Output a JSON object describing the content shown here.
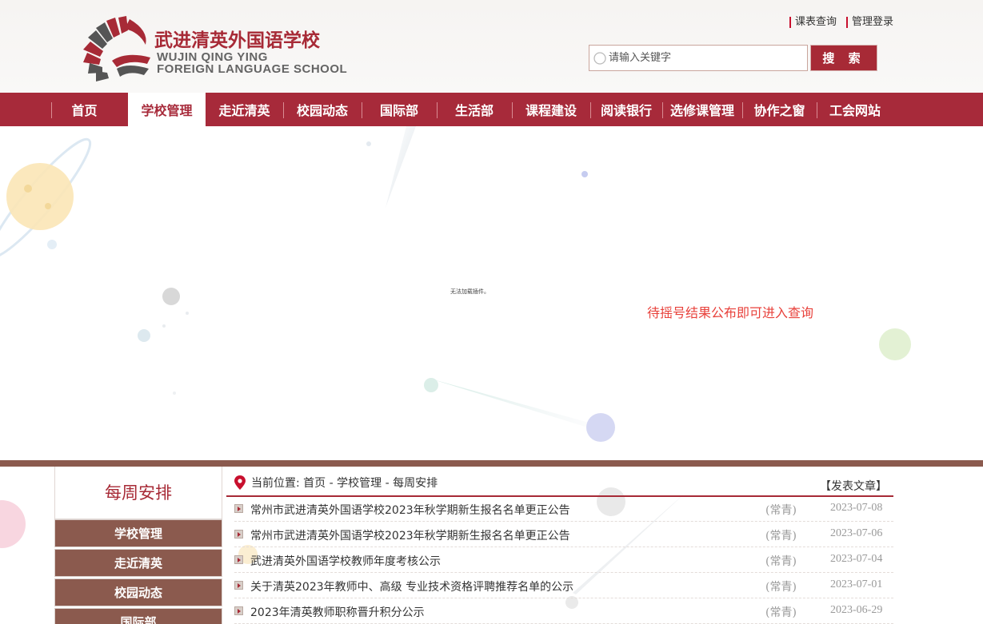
{
  "header": {
    "school_name_cn": "武进清英外国语学校",
    "school_name_en_line1": "WUJIN QING YING",
    "school_name_en_line2": "FOREIGN LANGUAGE SCHOOL",
    "top_links": [
      {
        "label": "课表查询"
      },
      {
        "label": "管理登录"
      }
    ],
    "search": {
      "placeholder": "请输入关键字",
      "button_label": "搜 索"
    }
  },
  "nav": {
    "items": [
      {
        "label": "首页"
      },
      {
        "label": "学校管理",
        "active": true
      },
      {
        "label": "走近清英"
      },
      {
        "label": "校园动态"
      },
      {
        "label": "国际部"
      },
      {
        "label": "生活部"
      },
      {
        "label": "课程建设"
      },
      {
        "label": "阅读银行"
      },
      {
        "label": "选修课管理"
      },
      {
        "label": "协作之窗"
      },
      {
        "label": "工会网站"
      }
    ]
  },
  "banner": {
    "plugin_message": "无法加载插件。",
    "lottery_message": "待摇号结果公布即可进入查询"
  },
  "sidebar": {
    "title": "每周安排",
    "menu": [
      {
        "label": "学校管理"
      },
      {
        "label": "走近清英"
      },
      {
        "label": "校园动态"
      },
      {
        "label": "国际部"
      }
    ]
  },
  "main": {
    "breadcrumb": "当前位置: 首页 - 学校管理 - 每周安排",
    "post_link": "【发表文章】",
    "articles": [
      {
        "title": "常州市武进清英外国语学校2023年秋学期新生报名名单更正公告",
        "tag": "(常青)",
        "date": "2023-07-08"
      },
      {
        "title": "常州市武进清英外国语学校2023年秋学期新生报名名单更正公告",
        "tag": "(常青)",
        "date": "2023-07-06"
      },
      {
        "title": "武进清英外国语学校教师年度考核公示",
        "tag": "(常青)",
        "date": "2023-07-04"
      },
      {
        "title": "关于清英2023年教师中、高级 专业技术资格评聘推荐名单的公示",
        "tag": "(常青)",
        "date": "2023-07-01"
      },
      {
        "title": "2023年清英教师职称晋升积分公示",
        "tag": "(常青)",
        "date": "2023-06-29"
      }
    ]
  },
  "colors": {
    "brand_red": "#a72a3a",
    "sidebar_brown": "#8b5a4e",
    "alert_red": "#e8413b"
  }
}
